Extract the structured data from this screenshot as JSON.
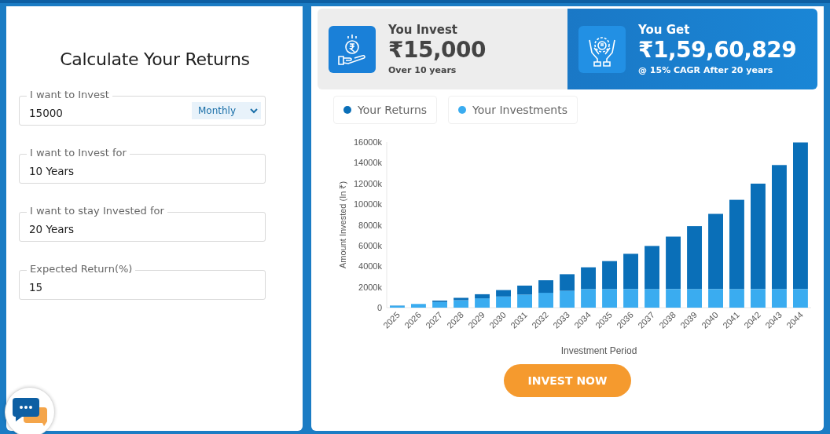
{
  "calculator": {
    "title": "Calculate Your Returns",
    "fields": [
      {
        "label": "I want to Invest",
        "value": "15000",
        "dropdown": "Monthly"
      },
      {
        "label": "I want to Invest for",
        "value": "10 Years"
      },
      {
        "label": "I want to stay Invested for",
        "value": "20 Years"
      },
      {
        "label": "Expected Return(%)",
        "value": "15"
      }
    ]
  },
  "summary": [
    {
      "kind": "invest",
      "title": "You Invest",
      "amount": "₹15,000",
      "note": "Over 10 years"
    },
    {
      "kind": "get",
      "title": "You Get",
      "amount": "₹1,59,60,829",
      "note": "@ 15% CAGR After 20 years"
    }
  ],
  "chart_data": {
    "type": "bar",
    "stacked": true,
    "xlabel": "Investment Period",
    "ylabel": "Amount Invested (In ₹)",
    "categories": [
      "2025",
      "2026",
      "2027",
      "2028",
      "2029",
      "2030",
      "2031",
      "2032",
      "2033",
      "2034",
      "2035",
      "2036",
      "2037",
      "2038",
      "2039",
      "2040",
      "2041",
      "2042",
      "2043",
      "2044"
    ],
    "series": [
      {
        "name": "Your Investments",
        "color": "#3aacf0",
        "values": [
          180,
          360,
          540,
          720,
          900,
          1080,
          1260,
          1440,
          1620,
          1800,
          1800,
          1800,
          1800,
          1800,
          1800,
          1800,
          1800,
          1800,
          1800,
          1800
        ]
      },
      {
        "name": "Your Returns",
        "color": "#0a6fb8",
        "values": [
          20,
          null,
          140,
          230,
          400,
          620,
          870,
          1210,
          1610,
          2100,
          2700,
          3400,
          4160,
          5060,
          6080,
          7260,
          8620,
          10180,
          11980,
          14160
        ]
      }
    ],
    "ylim": [
      0,
      16000
    ],
    "yticks": [
      {
        "value": 0,
        "label": "0"
      },
      {
        "value": 2000,
        "label": "2000k"
      },
      {
        "value": 4000,
        "label": "4000k"
      },
      {
        "value": 6000,
        "label": "6000k"
      },
      {
        "value": 8000,
        "label": "8000k"
      },
      {
        "value": 10000,
        "label": "10000k"
      },
      {
        "value": 12000,
        "label": "12000k"
      },
      {
        "value": 14000,
        "label": "14000k"
      },
      {
        "value": 16000,
        "label": "16000k"
      }
    ]
  },
  "cta": {
    "label": "INVEST NOW"
  }
}
